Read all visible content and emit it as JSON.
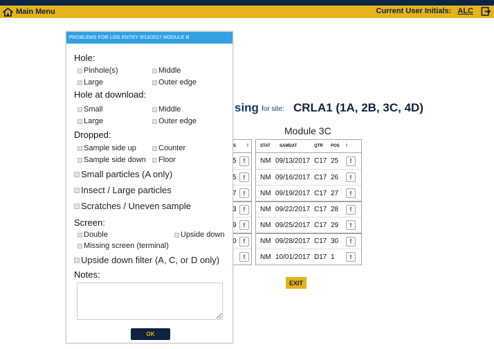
{
  "topbar": {
    "main_menu": "Main Menu",
    "user_label": "Current User Initials:",
    "user_initials": "ALC"
  },
  "page": {
    "title_partial": "sing",
    "site_label": "for site:",
    "site_value": "CRLA1   (1A, 2B, 3C, 4D)",
    "module_title": "Module 3C",
    "left_header": [
      "S",
      "!"
    ],
    "left_rows": [
      "5",
      "5",
      "7",
      "3",
      "9",
      "0",
      ""
    ],
    "table_headers": [
      "STAT",
      "SAMDAT",
      "QTR",
      "POS",
      "!"
    ],
    "rows": [
      {
        "stat": "NM",
        "date": "09/13/2017",
        "qtr": "C17",
        "pos": "25",
        "btn": "!"
      },
      {
        "stat": "NM",
        "date": "09/16/2017",
        "qtr": "C17",
        "pos": "26",
        "btn": "!"
      },
      {
        "stat": "NM",
        "date": "09/19/2017",
        "qtr": "C17",
        "pos": "27",
        "btn": "!"
      },
      {
        "stat": "NM",
        "date": "09/22/2017",
        "qtr": "C17",
        "pos": "28",
        "btn": "!"
      },
      {
        "stat": "NM",
        "date": "09/25/2017",
        "qtr": "C17",
        "pos": "29",
        "btn": "!"
      },
      {
        "stat": "NM",
        "date": "09/28/2017",
        "qtr": "C17",
        "pos": "30",
        "btn": "!"
      },
      {
        "stat": "NM",
        "date": "10/01/2017",
        "qtr": "D17",
        "pos": "1",
        "btn": "!"
      }
    ],
    "exit_label": "EXIT"
  },
  "modal": {
    "title": "PROBLEMS FOR LOG ENTRY 9/13/2017 MODULE B",
    "hole": {
      "label": "Hole:",
      "options": [
        "Pinhole(s)",
        "Middle",
        "Large",
        "Outer edge"
      ]
    },
    "hole_download": {
      "label": "Hole at download:",
      "options": [
        "Small",
        "Middle",
        "Large",
        "Outer edge"
      ]
    },
    "dropped": {
      "label": "Dropped:",
      "options": [
        "Sample side up",
        "Counter",
        "Sample side down",
        "Floor"
      ]
    },
    "small_particles": "Small particles (A only)",
    "insect": "Insect / Large particles",
    "scratches": "Scratches / Uneven sample",
    "screen": {
      "label": "Screen:",
      "options": [
        "Double",
        "Upside down",
        "Missing screen (terminal)"
      ]
    },
    "upside_filter": "Upside down filter (A, C, or D only)",
    "notes_label": "Notes:",
    "ok_label": "OK"
  }
}
